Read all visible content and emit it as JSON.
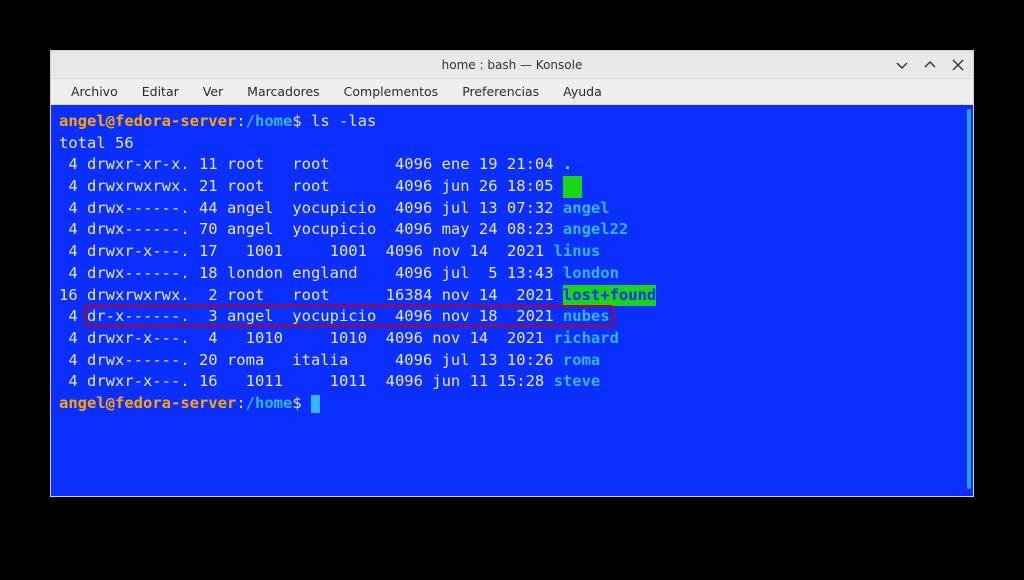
{
  "window": {
    "title": "home : bash — Konsole"
  },
  "menubar": {
    "archivo": "Archivo",
    "editar": "Editar",
    "ver": "Ver",
    "marcadores": "Marcadores",
    "complementos": "Complementos",
    "preferencias": "Preferencias",
    "ayuda": "Ayuda"
  },
  "prompt": {
    "user_host": "angel@fedora-server",
    "colon": ":",
    "path": "/home",
    "sign": "$ "
  },
  "command": "ls -las",
  "total_line": "total 56",
  "rows": [
    {
      "blocks": " 4",
      "perm": "drwxr-xr-x.",
      "links": "11",
      "owner": "root  ",
      "group": "root    ",
      "size": "  4096",
      "date": "ene 19 21:04",
      "name": ".",
      "style": "dot"
    },
    {
      "blocks": " 4",
      "perm": "drwxrwxrwx.",
      "links": "21",
      "owner": "root  ",
      "group": "root    ",
      "size": "  4096",
      "date": "jun 26 18:05",
      "name": "..",
      "style": "green_dotdot"
    },
    {
      "blocks": " 4",
      "perm": "drwx------.",
      "links": "44",
      "owner": "angel ",
      "group": "yocupicio",
      "size": " 4096",
      "date": "jul 13 07:32",
      "name": "angel",
      "style": "dir"
    },
    {
      "blocks": " 4",
      "perm": "drwx------.",
      "links": "70",
      "owner": "angel ",
      "group": "yocupicio",
      "size": " 4096",
      "date": "may 24 08:23",
      "name": "angel22",
      "style": "dir"
    },
    {
      "blocks": " 4",
      "perm": "drwxr-x---.",
      "links": "17",
      "owner": "  1001",
      "group": "    1001",
      "size": " 4096",
      "date": "nov 14  2021",
      "name": "linus",
      "style": "dir"
    },
    {
      "blocks": " 4",
      "perm": "drwx------.",
      "links": "18",
      "owner": "london",
      "group": "england ",
      "size": "  4096",
      "date": "jul  5 13:43",
      "name": "london",
      "style": "dir"
    },
    {
      "blocks": "16",
      "perm": "drwxrwxrwx.",
      "links": " 2",
      "owner": "root  ",
      "group": "root    ",
      "size": " 16384",
      "date": "nov 14  2021",
      "name": "lost+found",
      "style": "green_block"
    },
    {
      "blocks": " 4",
      "perm": "dr-x------.",
      "links": " 3",
      "owner": "angel ",
      "group": "yocupicio",
      "size": " 4096",
      "date": "nov 18  2021",
      "name": "nubes",
      "style": "dir",
      "highlighted": true
    },
    {
      "blocks": " 4",
      "perm": "drwxr-x---.",
      "links": " 4",
      "owner": "  1010",
      "group": "    1010",
      "size": " 4096",
      "date": "nov 14  2021",
      "name": "richard",
      "style": "dir"
    },
    {
      "blocks": " 4",
      "perm": "drwx------.",
      "links": "20",
      "owner": "roma  ",
      "group": "italia  ",
      "size": "  4096",
      "date": "jul 13 10:26",
      "name": "roma",
      "style": "dir"
    },
    {
      "blocks": " 4",
      "perm": "drwxr-x---.",
      "links": "16",
      "owner": "  1011",
      "group": "    1011",
      "size": " 4096",
      "date": "jun 11 15:28",
      "name": "steve",
      "style": "dir"
    }
  ],
  "colors": {
    "terminal_bg": "#0a2fff",
    "prompt_user": "#ffa500",
    "prompt_path": "#33b7ff",
    "dir_name": "#33b7ff",
    "highlight_green_bg": "#19d419",
    "highlight_red_border": "#c00018"
  }
}
